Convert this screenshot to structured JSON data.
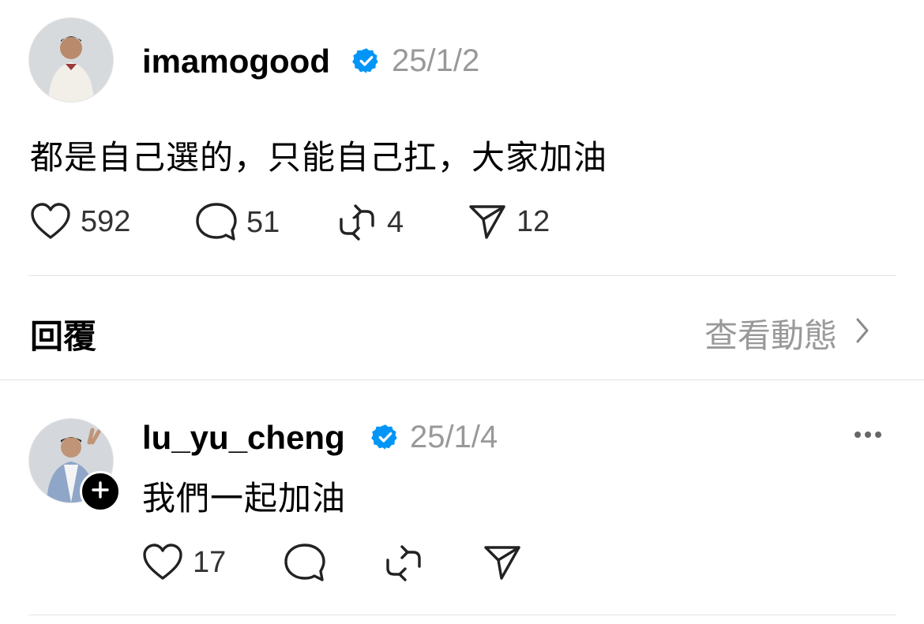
{
  "post": {
    "username": "imamogood",
    "date": "25/1/2",
    "text": "都是自己選的，只能自己扛，大家加油",
    "likes": "592",
    "comments": "51",
    "reposts": "4",
    "shares": "12",
    "verified_icon": "verified-badge-icon"
  },
  "replies_header": {
    "title": "回覆",
    "view_activity": "查看動態"
  },
  "reply": {
    "username": "lu_yu_cheng",
    "date": "25/1/4",
    "text": "我們一起加油",
    "likes": "17"
  },
  "colors": {
    "verified": "#0095f6",
    "muted": "#999999",
    "divider": "#e3e3e3"
  }
}
